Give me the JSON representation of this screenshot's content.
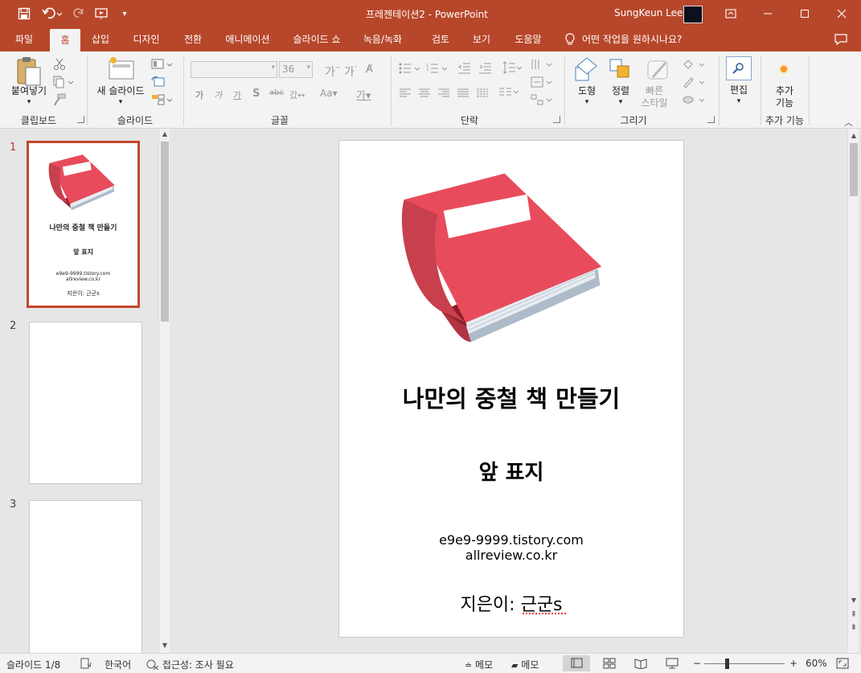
{
  "window": {
    "doc_title": "프레젠테이션2",
    "separator": "-",
    "app_name": "PowerPoint",
    "user_name": "SungKeun Lee"
  },
  "tabs": [
    {
      "label": "파일"
    },
    {
      "label": "홈"
    },
    {
      "label": "삽입"
    },
    {
      "label": "디자인"
    },
    {
      "label": "전환"
    },
    {
      "label": "애니메이션"
    },
    {
      "label": "슬라이드 쇼"
    },
    {
      "label": "녹음/녹화"
    },
    {
      "label": "검토"
    },
    {
      "label": "보기"
    },
    {
      "label": "도움말"
    }
  ],
  "tell_me": "어떤 작업을 원하시나요?",
  "ribbon": {
    "clipboard": {
      "paste": "붙여넣기",
      "group": "클립보드"
    },
    "slides": {
      "new_slide_line1": "새 슬라이드",
      "group": "슬라이드"
    },
    "font": {
      "size": "36",
      "group": "글꼴"
    },
    "paragraph": {
      "group": "단락"
    },
    "drawing": {
      "shape": "도형",
      "arrange": "정렬",
      "quick_style_line1": "빠른",
      "quick_style_line2": "스타일",
      "group": "그리기"
    },
    "editing": {
      "label": "편집"
    },
    "addins": {
      "label_line1": "추가",
      "label_line2": "기능",
      "group": "추가 기능"
    }
  },
  "slides": [
    {
      "number": "1",
      "selected": true
    },
    {
      "number": "2",
      "selected": false
    },
    {
      "number": "3",
      "selected": false
    }
  ],
  "slide1": {
    "title": "나만의 중철 책 만들기",
    "subtitle": "앞 표지",
    "url1": "e9e9-9999.tistory.com",
    "url2": "allreview.co.kr",
    "author": "지은이: 근군s"
  },
  "status": {
    "slide_pos": "슬라이드 1/8",
    "language": "한국어",
    "accessibility": "접근성: 조사 필요",
    "notes": "메모",
    "comments": "메모",
    "zoom": "60%"
  },
  "colors": {
    "accent": "#b7472a",
    "book_red": "#e84c5c"
  }
}
